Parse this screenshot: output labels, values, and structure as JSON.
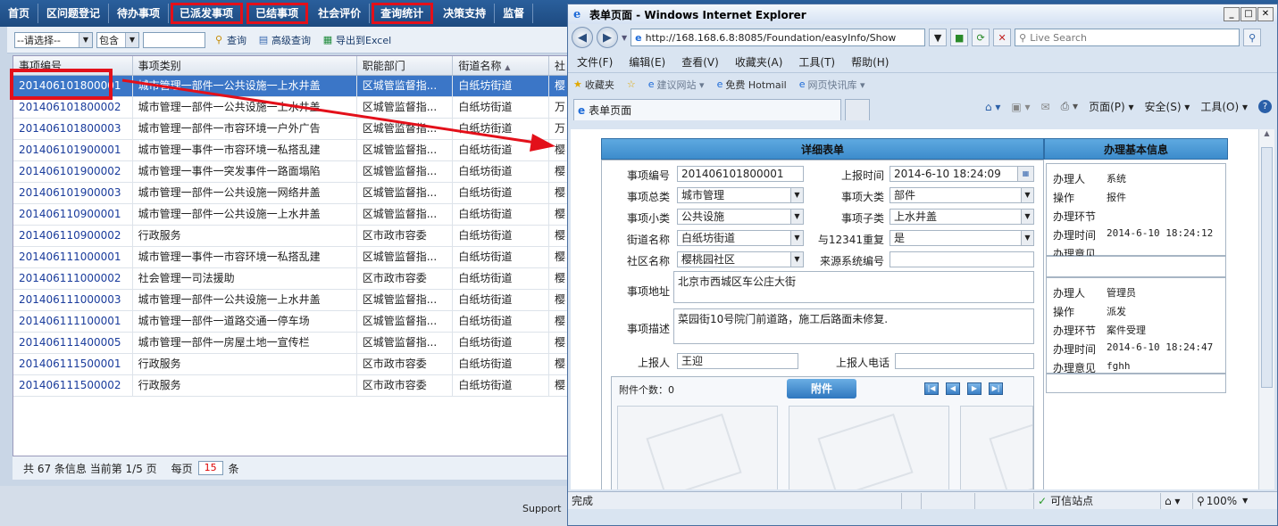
{
  "nav": {
    "items": [
      {
        "label": "首页",
        "highlight": false
      },
      {
        "label": "区问题登记",
        "highlight": false
      },
      {
        "label": "待办事项",
        "highlight": false
      },
      {
        "label": "已派发事项",
        "highlight": true
      },
      {
        "label": "已结事项",
        "highlight": true
      },
      {
        "label": "社会评价",
        "highlight": false
      },
      {
        "label": "查询统计",
        "highlight": true
      },
      {
        "label": "决策支持",
        "highlight": false
      },
      {
        "label": "监督",
        "highlight": false
      }
    ]
  },
  "toolbar": {
    "select_value": "--请选择--",
    "op_value": "包含",
    "search_value": "",
    "query_label": "查询",
    "advanced_label": "高级查询",
    "export_label": "导出到Excel"
  },
  "grid": {
    "columns": [
      "事项编号",
      "事项类别",
      "职能部门",
      "街道名称",
      "社"
    ],
    "rows": [
      [
        "201406101800001",
        "城市管理一部件一公共设施一上水井盖",
        "区城管监督指...",
        "白纸坊街道",
        "樱"
      ],
      [
        "201406101800002",
        "城市管理一部件一公共设施一上水井盖",
        "区城管监督指...",
        "白纸坊街道",
        "万"
      ],
      [
        "201406101800003",
        "城市管理一部件一市容环境一户外广告",
        "区城管监督指...",
        "白纸坊街道",
        "万"
      ],
      [
        "201406101900001",
        "城市管理一事件一市容环境一私搭乱建",
        "区城管监督指...",
        "白纸坊街道",
        "樱"
      ],
      [
        "201406101900002",
        "城市管理一事件一突发事件一路面塌陷",
        "区城管监督指...",
        "白纸坊街道",
        "樱"
      ],
      [
        "201406101900003",
        "城市管理一部件一公共设施一网络井盖",
        "区城管监督指...",
        "白纸坊街道",
        "樱"
      ],
      [
        "201406110900001",
        "城市管理一部件一公共设施一上水井盖",
        "区城管监督指...",
        "白纸坊街道",
        "樱"
      ],
      [
        "201406110900002",
        "行政服务",
        "区市政市容委",
        "白纸坊街道",
        "樱"
      ],
      [
        "201406111000001",
        "城市管理一事件一市容环境一私搭乱建",
        "区城管监督指...",
        "白纸坊街道",
        "樱"
      ],
      [
        "201406111000002",
        "社会管理一司法援助",
        "区市政市容委",
        "白纸坊街道",
        "樱"
      ],
      [
        "201406111000003",
        "城市管理一部件一公共设施一上水井盖",
        "区城管监督指...",
        "白纸坊街道",
        "樱"
      ],
      [
        "201406111100001",
        "城市管理一部件一道路交通一停车场",
        "区城管监督指...",
        "白纸坊街道",
        "樱"
      ],
      [
        "201406111400005",
        "城市管理一部件一房屋土地一宣传栏",
        "区城管监督指...",
        "白纸坊街道",
        "樱"
      ],
      [
        "201406111500001",
        "行政服务",
        "区市政市容委",
        "白纸坊街道",
        "樱"
      ],
      [
        "201406111500002",
        "行政服务",
        "区市政市容委",
        "白纸坊街道",
        "樱"
      ]
    ],
    "selected_index": 0
  },
  "pager": {
    "summary": "共 67 条信息 当前第 1/5 页",
    "per_page_label": "每页",
    "per_page_value": "15",
    "unit": "条"
  },
  "support_text": "Support",
  "ie": {
    "title": "表单页面 - Windows Internet Explorer",
    "url": "http://168.168.6.8:8085/Foundation/easyInfo/Show",
    "search_placeholder": "Live Search",
    "menu": [
      "文件(F)",
      "编辑(E)",
      "查看(V)",
      "收藏夹(A)",
      "工具(T)",
      "帮助(H)"
    ],
    "favorites_label": "收藏夹",
    "fav_links": [
      "建议网站 ▾",
      "免费 Hotmail",
      "网页快讯库 ▾"
    ],
    "tab_label": "表单页面",
    "commands": [
      "页面(P) ▾",
      "安全(S) ▾",
      "工具(O) ▾"
    ],
    "status_text": "完成",
    "zone_text": "可信站点",
    "zoom_text": "100%"
  },
  "form": {
    "title": "详细表单",
    "info_title": "办理基本信息",
    "fields": {
      "item_no_label": "事项编号",
      "item_no": "201406101800001",
      "report_time_label": "上报时间",
      "report_time": "2014-6-10 18:24:09",
      "category_label": "事项总类",
      "category": "城市管理",
      "major_label": "事项大类",
      "major": "部件",
      "minor_label": "事项小类",
      "minor": "公共设施",
      "sub_label": "事项子类",
      "sub": "上水井盖",
      "street_label": "街道名称",
      "street": "白纸坊街道",
      "dup_label": "与12341重复",
      "dup": "是",
      "community_label": "社区名称",
      "community": "樱桃园社区",
      "source_label": "来源系统编号",
      "source": "",
      "address_label": "事项地址",
      "address": "北京市西城区车公庄大街",
      "desc_label": "事项描述",
      "desc": "菜园街10号院门前道路，施工后路面未修复.",
      "reporter_label": "上报人",
      "reporter": "王迎",
      "phone_label": "上报人电话",
      "phone": ""
    },
    "attachments": {
      "count_label": "附件个数：0",
      "button_label": "附件"
    },
    "info_blocks": [
      {
        "rows": [
          {
            "k": "办理人",
            "v": "系统"
          },
          {
            "k": "操作",
            "v": "报件"
          },
          {
            "k": "办理环节",
            "v": ""
          },
          {
            "k": "办理时间",
            "v": "2014-6-10 18:24:12"
          },
          {
            "k": "办理意见",
            "v": ""
          }
        ]
      },
      {
        "rows": [
          {
            "k": "办理人",
            "v": "管理员"
          },
          {
            "k": "操作",
            "v": "派发"
          },
          {
            "k": "办理环节",
            "v": "案件受理"
          },
          {
            "k": "办理时间",
            "v": "2014-6-10 18:24:47"
          },
          {
            "k": "办理意见",
            "v": "fghh"
          }
        ]
      }
    ]
  },
  "colors": {
    "annotation_red": "#e3101a",
    "nav_blue": "#1d4a80",
    "selected_row": "#3b76c7"
  }
}
